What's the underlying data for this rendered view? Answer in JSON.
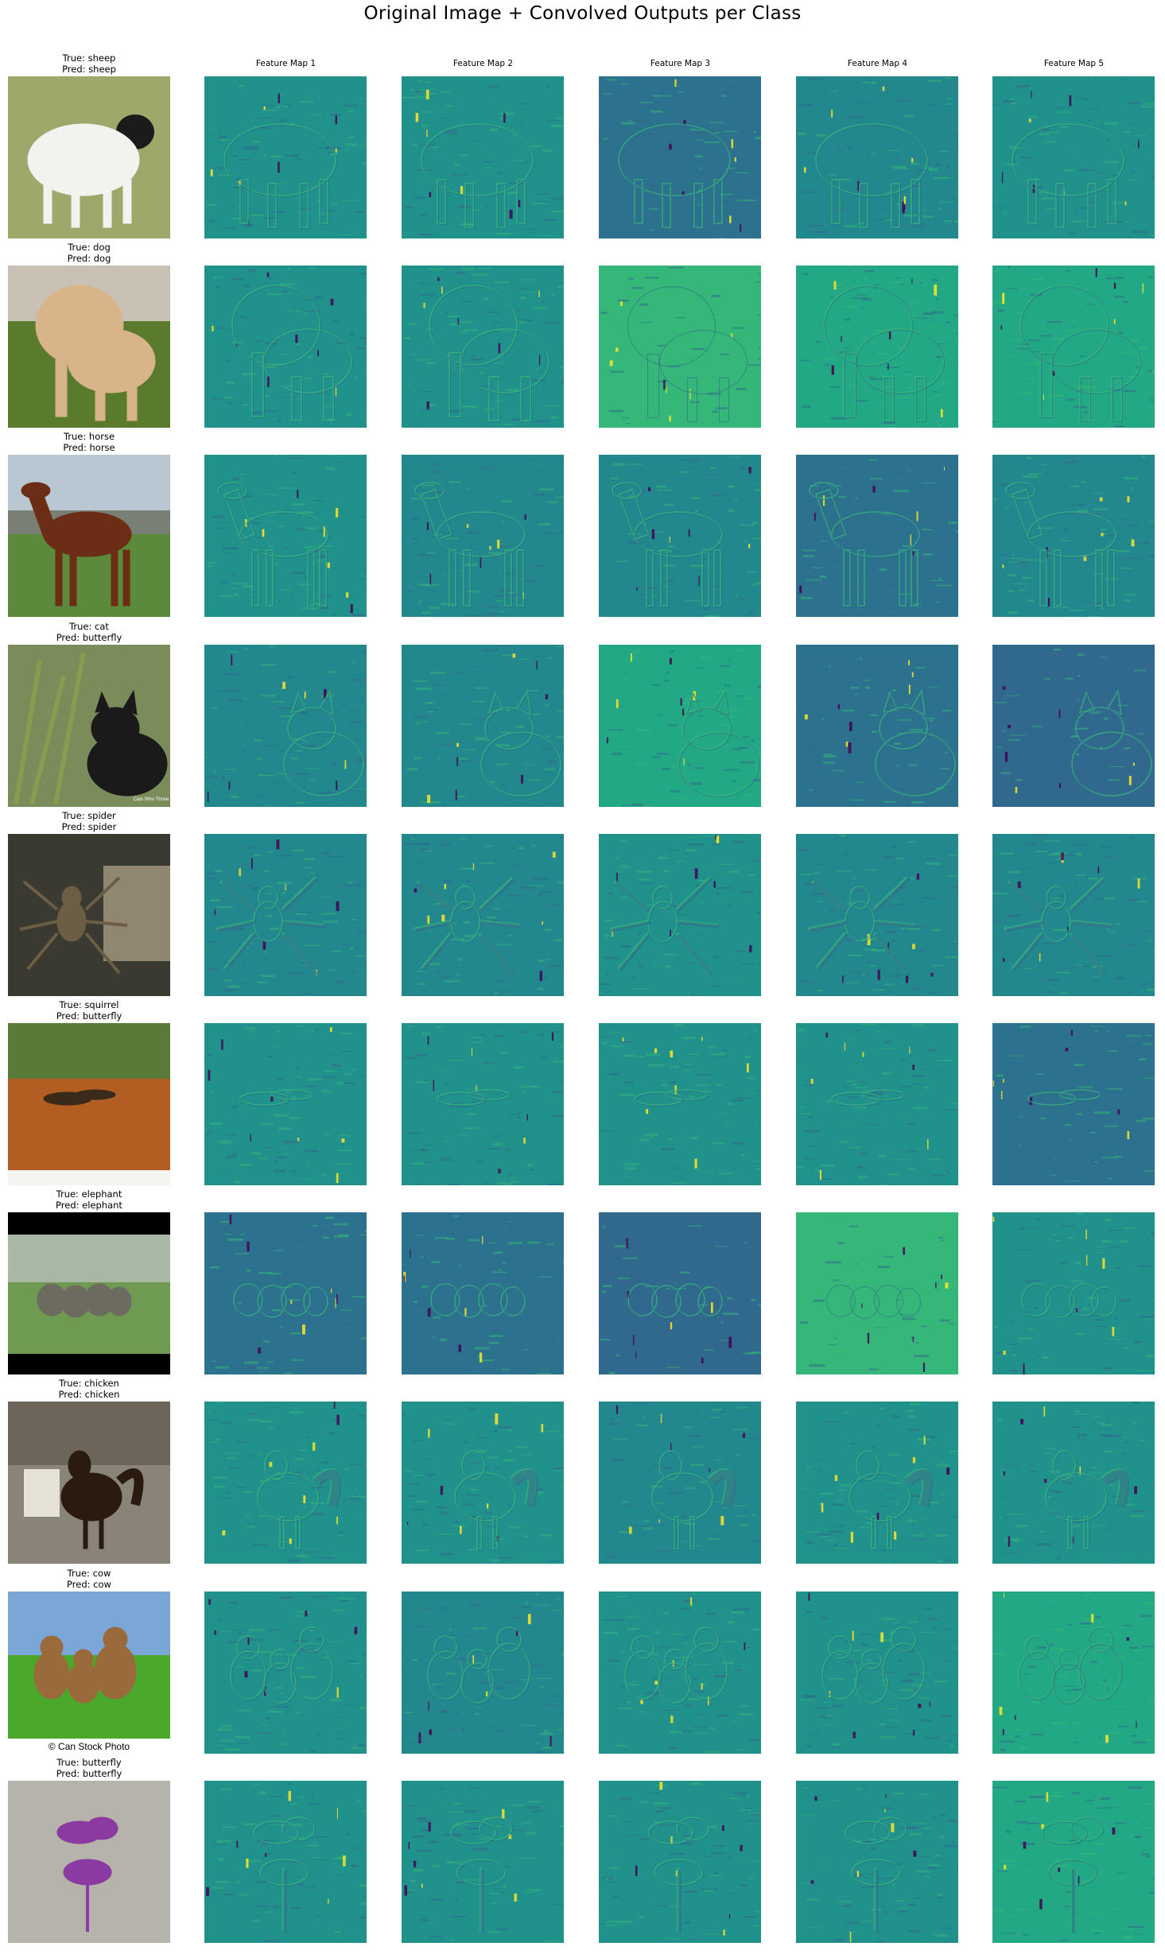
{
  "title": "Original Image + Convolved Outputs per Class",
  "feature_maps": [
    "Feature Map 1",
    "Feature Map 2",
    "Feature Map 3",
    "Feature Map 4",
    "Feature Map 5"
  ],
  "rows": [
    {
      "true_label": "True: sheep",
      "pred_label": "Pred: sheep",
      "subject": "sheep"
    },
    {
      "true_label": "True: dog",
      "pred_label": "Pred: dog",
      "subject": "dog"
    },
    {
      "true_label": "True: horse",
      "pred_label": "Pred: horse",
      "subject": "horse"
    },
    {
      "true_label": "True: cat",
      "pred_label": "Pred: butterfly",
      "subject": "cat"
    },
    {
      "true_label": "True: spider",
      "pred_label": "Pred: spider",
      "subject": "spider"
    },
    {
      "true_label": "True: squirrel",
      "pred_label": "Pred: butterfly",
      "subject": "squirrel"
    },
    {
      "true_label": "True: elephant",
      "pred_label": "Pred: elephant",
      "subject": "elephant"
    },
    {
      "true_label": "True: chicken",
      "pred_label": "Pred: chicken",
      "subject": "chicken"
    },
    {
      "true_label": "True: cow",
      "pred_label": "Pred: cow",
      "subject": "cow"
    },
    {
      "true_label": "True: butterfly",
      "pred_label": "Pred: butterfly",
      "subject": "butterfly"
    }
  ],
  "colors": {
    "viridis_mid": "#21918c",
    "viridis_dark": "#31688e",
    "viridis_light": "#35b779",
    "viridis_yellow": "#fde725",
    "viridis_purple": "#440154"
  },
  "watermarks": {
    "cat": "Cats Who Thrive",
    "cow": "© Can Stock Photo"
  }
}
